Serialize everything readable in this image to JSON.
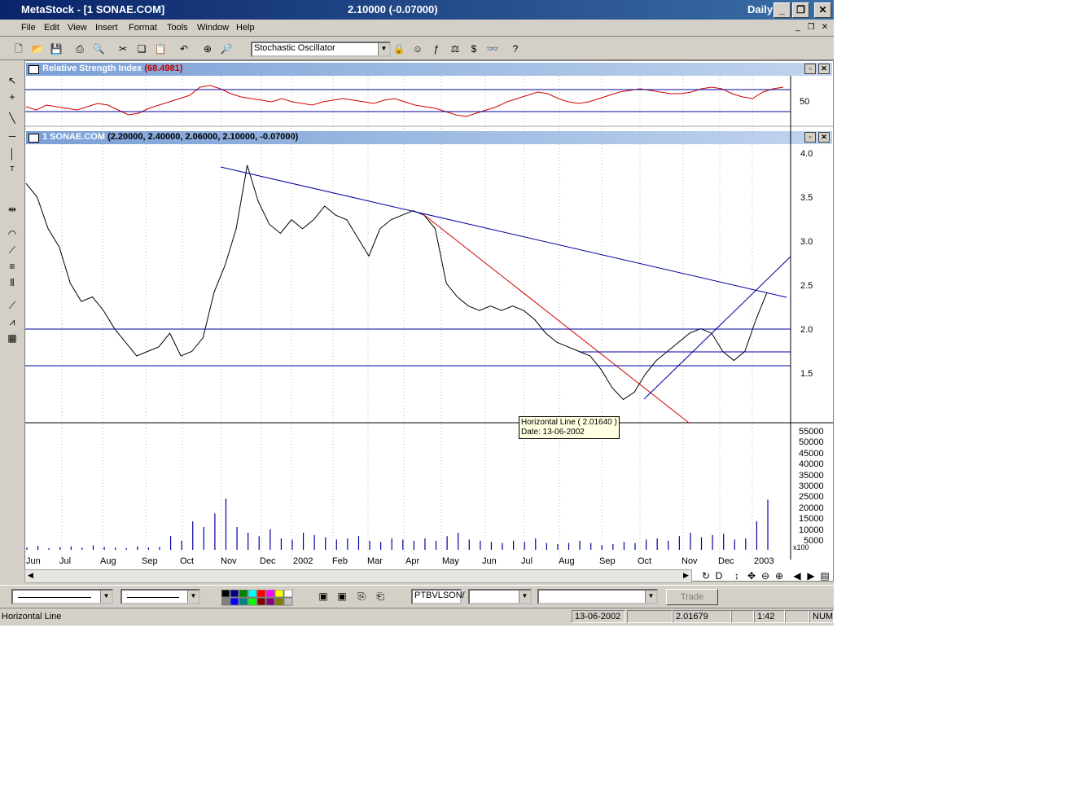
{
  "window": {
    "title": "MetaStock - [1 SONAE.COM]",
    "price_display": "2.10000 (-0.07000)",
    "period": "Daily",
    "minimize": "_",
    "restore": "❐",
    "close": "✕"
  },
  "menu": [
    "File",
    "Edit",
    "View",
    "Insert",
    "Format",
    "Tools",
    "Window",
    "Help"
  ],
  "toolbar": {
    "indicator_select": "Stochastic Oscillator"
  },
  "rsi_pane": {
    "title": "Relative Strength Index",
    "value": "(68.4981)",
    "ylabel": "50"
  },
  "price_pane": {
    "title": "1 SONAE.COM",
    "ohlc": "(2.20000, 2.40000, 2.06000, 2.10000, -0.07000)",
    "yticks": [
      "4.0",
      "3.5",
      "3.0",
      "2.5",
      "2.0",
      "1.5"
    ]
  },
  "volume_pane": {
    "yticks": [
      "55000",
      "50000",
      "45000",
      "40000",
      "35000",
      "30000",
      "25000",
      "20000",
      "15000",
      "10000",
      "5000"
    ],
    "unit": "x100"
  },
  "xaxis": [
    "Jun",
    "Jul",
    "Aug",
    "Sep",
    "Oct",
    "Nov",
    "Dec",
    "2002",
    "Feb",
    "Mar",
    "Apr",
    "May",
    "Jun",
    "Jul",
    "Aug",
    "Sep",
    "Oct",
    "Nov",
    "Dec",
    "2003"
  ],
  "tooltip": {
    "line1": "Horizontal Line ( 2.01640 )",
    "line2": "Date: 13-06-2002"
  },
  "bottom": {
    "security_field": "PTBVLSON/",
    "trade_button": "Trade"
  },
  "status": {
    "left": "Horizontal Line",
    "date": "13-06-2002",
    "value": "2.01679",
    "time": "1:42",
    "num": "NUM"
  },
  "chart_data": {
    "type": "line",
    "rsi": [
      52,
      50,
      53,
      52,
      51,
      50,
      52,
      54,
      53,
      50,
      47,
      48,
      51,
      53,
      55,
      57,
      59,
      64,
      65,
      63,
      60,
      58,
      57,
      56,
      55,
      57,
      55,
      54,
      53,
      55,
      56,
      57,
      56,
      55,
      54,
      56,
      57,
      55,
      53,
      52,
      51,
      49,
      47,
      46,
      48,
      50,
      52,
      55,
      57,
      59,
      61,
      60,
      57,
      55,
      54,
      55,
      57,
      59,
      61,
      62,
      63,
      62,
      61,
      60,
      60,
      61,
      63,
      64,
      63,
      60,
      58,
      57,
      61,
      63,
      64
    ],
    "price": [
      3.6,
      3.45,
      3.1,
      2.9,
      2.5,
      2.3,
      2.35,
      2.2,
      2.0,
      1.85,
      1.7,
      1.75,
      1.8,
      1.95,
      1.7,
      1.75,
      1.9,
      2.4,
      2.7,
      3.1,
      3.8,
      3.4,
      3.15,
      3.05,
      3.2,
      3.1,
      3.2,
      3.35,
      3.25,
      3.2,
      3.0,
      2.8,
      3.1,
      3.2,
      3.25,
      3.3,
      3.25,
      3.1,
      2.5,
      2.35,
      2.25,
      2.2,
      2.25,
      2.2,
      2.25,
      2.2,
      2.1,
      1.95,
      1.85,
      1.8,
      1.75,
      1.7,
      1.55,
      1.35,
      1.22,
      1.3,
      1.5,
      1.65,
      1.75,
      1.85,
      1.95,
      2.0,
      1.95,
      1.75,
      1.65,
      1.75,
      2.1,
      2.4
    ],
    "volume": [
      20,
      35,
      15,
      25,
      30,
      20,
      40,
      25,
      20,
      15,
      30,
      20,
      25,
      120,
      80,
      250,
      200,
      320,
      450,
      200,
      150,
      120,
      180,
      100,
      90,
      150,
      130,
      110,
      90,
      100,
      120,
      80,
      70,
      100,
      90,
      80,
      100,
      80,
      120,
      150,
      90,
      80,
      70,
      60,
      80,
      70,
      100,
      60,
      50,
      60,
      80,
      60,
      40,
      50,
      70,
      60,
      90,
      100,
      80,
      120,
      150,
      110,
      130,
      140,
      90,
      100,
      250,
      440
    ],
    "horizontal_lines": [
      2.0164,
      1.6
    ],
    "ylim": [
      1.0,
      4.1
    ]
  }
}
